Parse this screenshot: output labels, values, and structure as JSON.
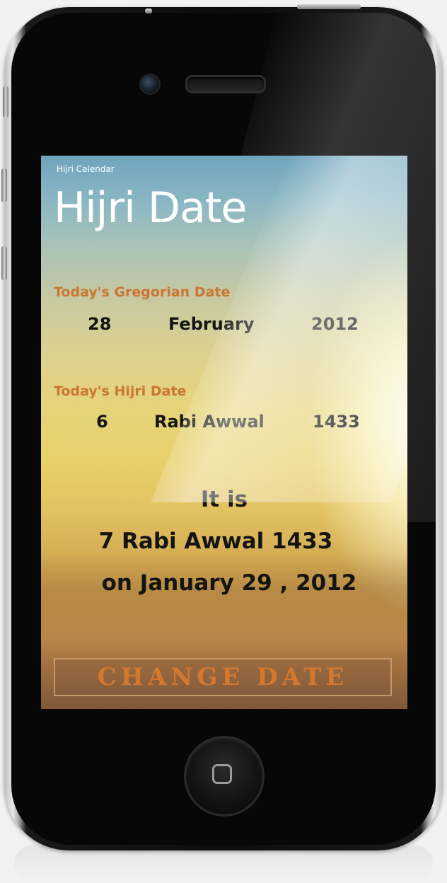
{
  "app": {
    "name": "Hijri Calendar",
    "page_title": "Hijri Date"
  },
  "gregorian": {
    "label": "Today's Gregorian Date",
    "day": "28",
    "month": "February",
    "year": "2012"
  },
  "hijri": {
    "label": "Today's Hijri Date",
    "day": "6",
    "month": "Rabi Awwal",
    "year": "1433"
  },
  "result": {
    "line1": "It  is",
    "line2": "7 Rabi Awwal 1433",
    "line3": "on January 29 , 2012"
  },
  "actions": {
    "change_date_label": "CHANGE DATE"
  },
  "colors": {
    "label_accent": "#c97630",
    "button_text": "#d4782e"
  },
  "icons": {
    "home": "home-square-icon"
  }
}
